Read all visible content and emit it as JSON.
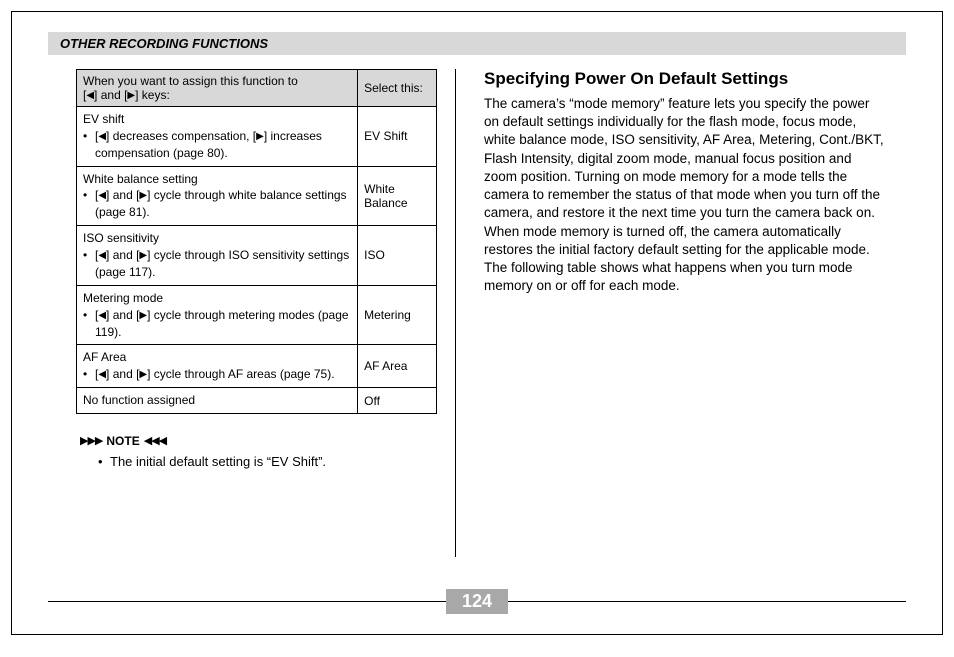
{
  "header": {
    "title": "OTHER RECORDING FUNCTIONS"
  },
  "table": {
    "head_left_l1": "When you want to assign this function to",
    "head_left_l2_pre": "[",
    "head_left_l2_mid": "] and [",
    "head_left_l2_post": "] keys:",
    "head_right": "Select this:",
    "rows": [
      {
        "title": "EV shift",
        "detail_pre": "[",
        "detail_mid": "] decreases compensation, [",
        "detail_post": "] increases compensation (page 80).",
        "select": "EV Shift"
      },
      {
        "title": "White balance setting",
        "detail_pre": "[",
        "detail_mid": "] and [",
        "detail_post": "] cycle through white balance settings (page 81).",
        "select": "White Balance"
      },
      {
        "title": "ISO sensitivity",
        "detail_pre": "[",
        "detail_mid": "] and [",
        "detail_post": "] cycle through ISO sensitivity settings (page 117).",
        "select": "ISO"
      },
      {
        "title": "Metering mode",
        "detail_pre": "[",
        "detail_mid": "] and [",
        "detail_post": "] cycle through metering modes (page 119).",
        "select": "Metering"
      },
      {
        "title": "AF Area",
        "detail_pre": "[",
        "detail_mid": "] and [",
        "detail_post": "] cycle through AF areas (page 75).",
        "select": "AF Area"
      },
      {
        "title_only": "No function assigned",
        "select": "Off"
      }
    ]
  },
  "note": {
    "label": "NOTE",
    "body": "The initial default setting is “EV Shift”."
  },
  "right": {
    "title": "Specifying Power On Default Settings",
    "p1": "The camera’s “mode memory” feature lets you specify the power on default settings individually for the flash mode, focus mode, white balance mode, ISO sensitivity, AF Area, Metering, Cont./BKT, Flash Intensity, digital zoom mode, manual focus position and zoom position. Turning on mode memory for a mode tells the camera to remember the status of that mode when you turn off the camera, and restore it the next time you turn the camera back on. When mode memory is turned off, the camera automatically restores the initial factory default setting for the applicable mode.",
    "p2": "The following table shows what happens when you turn mode memory on or off for each mode."
  },
  "glyphs": {
    "left_arrow": "◀",
    "right_arrow": "▶",
    "note_right": "▶▶▶",
    "note_left": "◀◀◀",
    "bullet": "•"
  },
  "page_number": "124"
}
